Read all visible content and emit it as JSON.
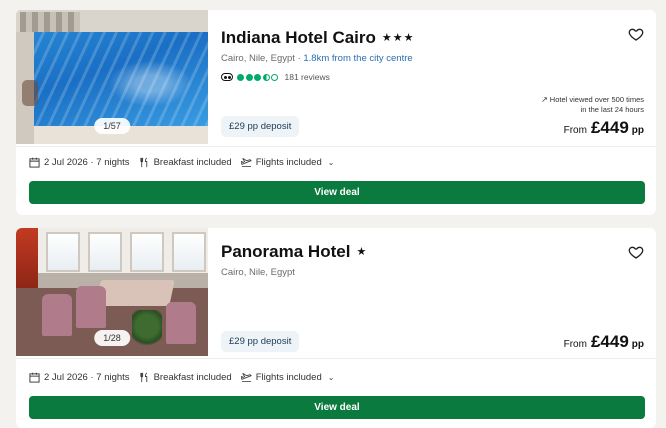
{
  "hotels": [
    {
      "name": "Indiana Hotel Cairo",
      "stars": "★★★",
      "location": "Cairo, Nile, Egypt",
      "distance": "1.8km from the city centre",
      "rating_bubbles": 3.5,
      "reviews": "181 reviews",
      "photo_counter": "1/57",
      "deposit": "£29 pp deposit",
      "viewed_line1": "Hotel viewed over 500 times",
      "viewed_line2": "in the last 24 hours",
      "price_from": "From",
      "price": "£449",
      "price_unit": "pp",
      "date_nights": "2 Jul 2026 · 7 nights",
      "board": "Breakfast included",
      "flights": "Flights included",
      "button": "View deal"
    },
    {
      "name": "Panorama Hotel",
      "stars": "★",
      "location": "Cairo, Nile, Egypt",
      "photo_counter": "1/28",
      "deposit": "£29 pp deposit",
      "price_from": "From",
      "price": "£449",
      "price_unit": "pp",
      "date_nights": "2 Jul 2026 · 7 nights",
      "board": "Breakfast included",
      "flights": "Flights included",
      "button": "View deal"
    }
  ],
  "icons": {
    "heart": "heart-outline-icon",
    "calendar": "calendar-icon",
    "meal": "cutlery-icon",
    "flight": "plane-icon",
    "chevron": "chevron-down-icon",
    "trend": "trending-up-icon",
    "tripadvisor": "owl-icon"
  },
  "colors": {
    "button_bg": "#0b7a3e",
    "rating_green": "#00aa6c",
    "distance_link": "#2a6fb0",
    "deposit_bg": "#eef3f8"
  }
}
